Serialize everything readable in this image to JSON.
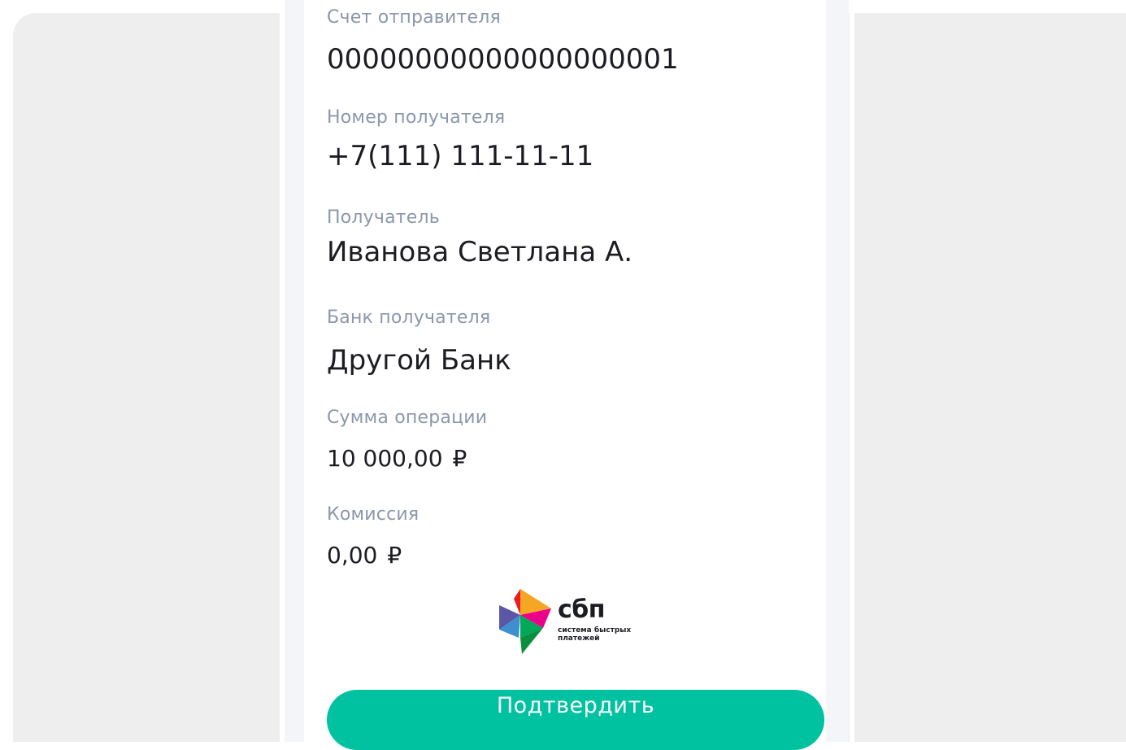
{
  "fields": [
    {
      "label": "Счет отправителя",
      "value": "00000000000000000001"
    },
    {
      "label": "Номер получателя",
      "value": "+7(111) 111-11-11"
    },
    {
      "label": "Получатель",
      "value": "Иванова Светлана А."
    },
    {
      "label": "Банк получателя",
      "value": "Другой Банк"
    },
    {
      "label": "Сумма операции",
      "value": "10 000,00",
      "currency": "₽"
    },
    {
      "label": "Комиссия",
      "value": "0,00",
      "currency": "₽"
    }
  ],
  "logo": {
    "name": "сбп",
    "tagline": "система быстрых платежей",
    "icon": "sbp-logo-icon"
  },
  "confirm_button": {
    "label": "Подтвердить"
  },
  "colors": {
    "accent": "#00c2a1",
    "label": "#8b97ad",
    "text": "#1c1d22",
    "background": "#eeeeef"
  }
}
